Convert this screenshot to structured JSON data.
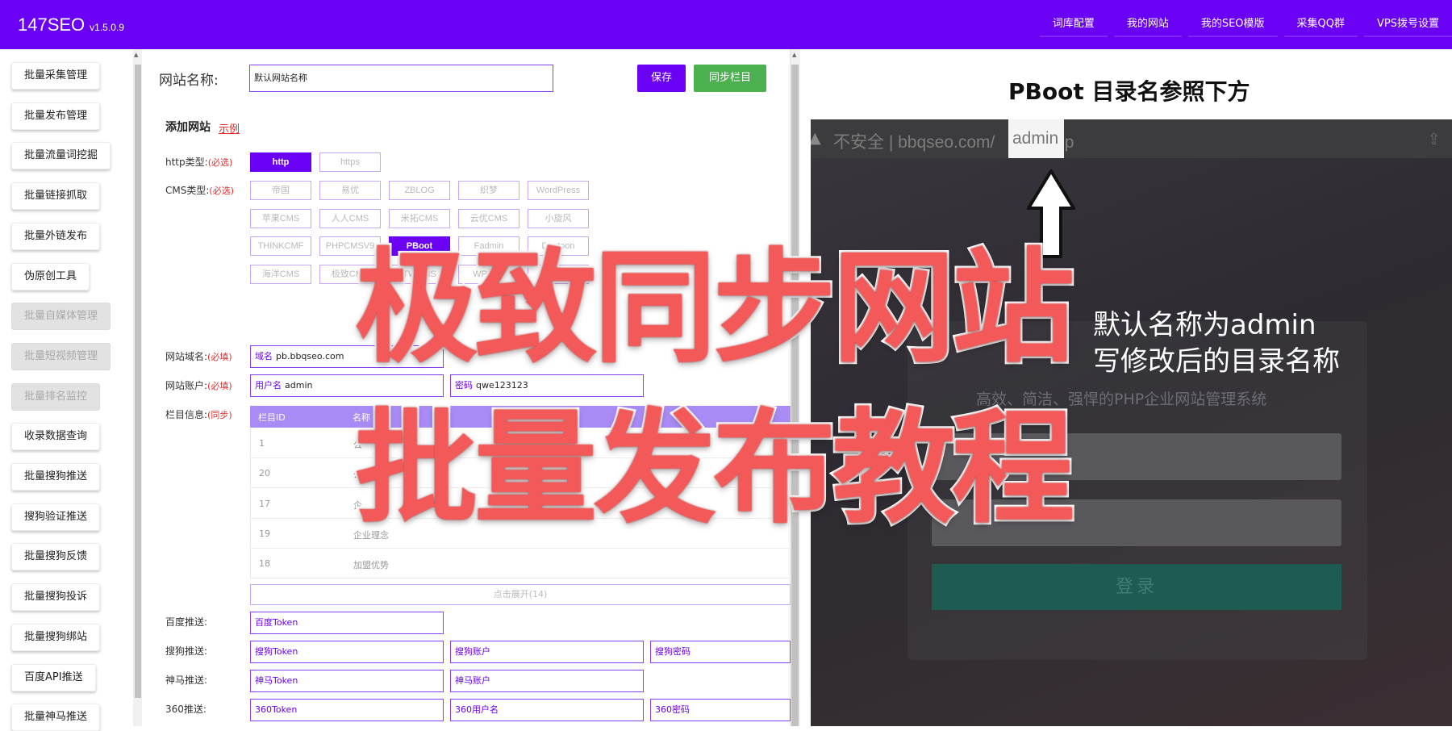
{
  "app": {
    "name": "147SEO",
    "version": "v1.5.0.9"
  },
  "topnav": [
    "词库配置",
    "我的网站",
    "我的SEO模版",
    "采集QQ群",
    "VPS拨号设置"
  ],
  "sidebar": [
    {
      "label": "批量采集管理",
      "disabled": false
    },
    {
      "label": "批量发布管理",
      "disabled": false
    },
    {
      "label": "批量流量词挖掘",
      "disabled": false
    },
    {
      "label": "批量链接抓取",
      "disabled": false
    },
    {
      "label": "批量外链发布",
      "disabled": false
    },
    {
      "label": "伪原创工具",
      "disabled": false
    },
    {
      "label": "批量自媒体管理",
      "disabled": true
    },
    {
      "label": "批量短视频管理",
      "disabled": true
    },
    {
      "label": "批量排名监控",
      "disabled": true
    },
    {
      "label": "收录数据查询",
      "disabled": false
    },
    {
      "label": "批量搜狗推送",
      "disabled": false
    },
    {
      "label": "搜狗验证推送",
      "disabled": false
    },
    {
      "label": "批量搜狗反馈",
      "disabled": false
    },
    {
      "label": "批量搜狗投诉",
      "disabled": false
    },
    {
      "label": "批量搜狗绑站",
      "disabled": false
    },
    {
      "label": "百度API推送",
      "disabled": false
    },
    {
      "label": "批量神马推送",
      "disabled": false
    }
  ],
  "form": {
    "site_name_label": "网站名称:",
    "site_name_value": "默认网站名称",
    "save_button": "保存",
    "sync_button": "同步栏目",
    "section_title": "添加网站",
    "example_link": "示例",
    "required": "(必选)",
    "required_fill": "(必填)",
    "sync_tag": "(同步)",
    "http_label": "http类型:",
    "http_options": [
      {
        "label": "http",
        "selected": true
      },
      {
        "label": "https",
        "selected": false
      }
    ],
    "cms_label": "CMS类型:",
    "cms_options": [
      {
        "label": "帝国",
        "selected": false
      },
      {
        "label": "易优",
        "selected": false
      },
      {
        "label": "ZBLOG",
        "selected": false
      },
      {
        "label": "织梦",
        "selected": false
      },
      {
        "label": "WordPress",
        "selected": false
      },
      {
        "label": "苹果CMS",
        "selected": false
      },
      {
        "label": "人人CMS",
        "selected": false
      },
      {
        "label": "米拓CMS",
        "selected": false
      },
      {
        "label": "云优CMS",
        "selected": false
      },
      {
        "label": "小旋风",
        "selected": false
      },
      {
        "label": "THINKCMF",
        "selected": false
      },
      {
        "label": "PHPCMSV9",
        "selected": false
      },
      {
        "label": "PBoot",
        "selected": true
      },
      {
        "label": "Fadmin",
        "selected": false
      },
      {
        "label": "Destoon",
        "selected": false
      },
      {
        "label": "海洋CMS",
        "selected": false
      },
      {
        "label": "极致CMS",
        "selected": false
      },
      {
        "label": "TWCMS",
        "selected": false
      },
      {
        "label": "WP社区",
        "selected": false
      },
      {
        "label": "其他1",
        "selected": false
      }
    ],
    "domain_label": "网站域名:",
    "domain_prefix": "域名",
    "domain_value": "pb.bbqseo.com",
    "account_label": "网站账户:",
    "username_prefix": "用户名",
    "username_value": "admin",
    "password_prefix": "密码",
    "password_value": "qwe123123",
    "columns_label": "栏目信息:",
    "table_headers": [
      "栏目ID",
      "名称"
    ],
    "table_rows": [
      {
        "id": "1",
        "name": "公"
      },
      {
        "id": "20",
        "name": "公"
      },
      {
        "id": "17",
        "name": "企"
      },
      {
        "id": "19",
        "name": "企业理念"
      },
      {
        "id": "18",
        "name": "加盟优势"
      }
    ],
    "expand_text": "点击展开(14)",
    "baidu_label": "百度推送:",
    "baidu_token": "百度Token",
    "sogou_label": "搜狗推送:",
    "sogou_token": "搜狗Token",
    "sogou_account": "搜狗账户",
    "sogou_password": "搜狗密码",
    "shenma_label": "神马推送:",
    "shenma_token": "神马Token",
    "shenma_account": "神马账户",
    "p360_label": "360推送:",
    "p360_token": "360Token",
    "p360_user": "360用户名",
    "p360_password": "360密码"
  },
  "right_panel": {
    "title": "PBoot 目录名参照下方",
    "url_warning": "不安全",
    "url_domain": "bbqseo.com/",
    "url_highlight": "admin",
    "url_suffix": ".php",
    "hint_line1": "默认名称为admin",
    "hint_line2": "写修改后的目录名称",
    "slogan": "高效、简洁、强悍的PHP企业网站管理系统",
    "login_button": "登录"
  },
  "overlay": {
    "line1": "极致同步网站",
    "line2": "批量发布教程"
  },
  "colors": {
    "brand": "#6a00f4",
    "sync_green": "#4caf50",
    "overlay_red": "#f35959",
    "table_head": "#a98bf5"
  }
}
